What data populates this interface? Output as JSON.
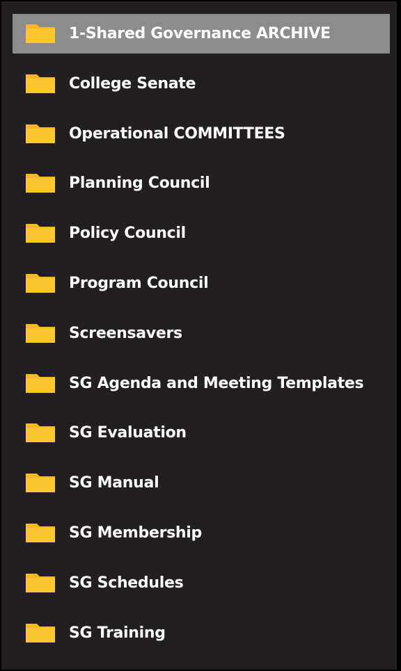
{
  "colors": {
    "panel_background": "#231f20",
    "selected_background": "#8c8c8c",
    "text": "#ffffff",
    "folder_icon": "#f6b820"
  },
  "folders": [
    {
      "label": "1-Shared Governance ARCHIVE",
      "icon": "folder-icon",
      "selected": true
    },
    {
      "label": "College Senate",
      "icon": "folder-icon",
      "selected": false
    },
    {
      "label": "Operational COMMITTEES",
      "icon": "folder-icon",
      "selected": false
    },
    {
      "label": "Planning Council",
      "icon": "folder-icon",
      "selected": false
    },
    {
      "label": "Policy Council",
      "icon": "folder-icon",
      "selected": false
    },
    {
      "label": "Program Council",
      "icon": "folder-icon",
      "selected": false
    },
    {
      "label": "Screensavers",
      "icon": "folder-icon",
      "selected": false
    },
    {
      "label": "SG Agenda and Meeting Templates",
      "icon": "folder-icon",
      "selected": false
    },
    {
      "label": "SG Evaluation",
      "icon": "folder-icon",
      "selected": false
    },
    {
      "label": "SG Manual",
      "icon": "folder-icon",
      "selected": false
    },
    {
      "label": "SG Membership",
      "icon": "folder-icon",
      "selected": false
    },
    {
      "label": "SG Schedules",
      "icon": "folder-icon",
      "selected": false
    },
    {
      "label": "SG Training",
      "icon": "folder-icon",
      "selected": false
    }
  ]
}
